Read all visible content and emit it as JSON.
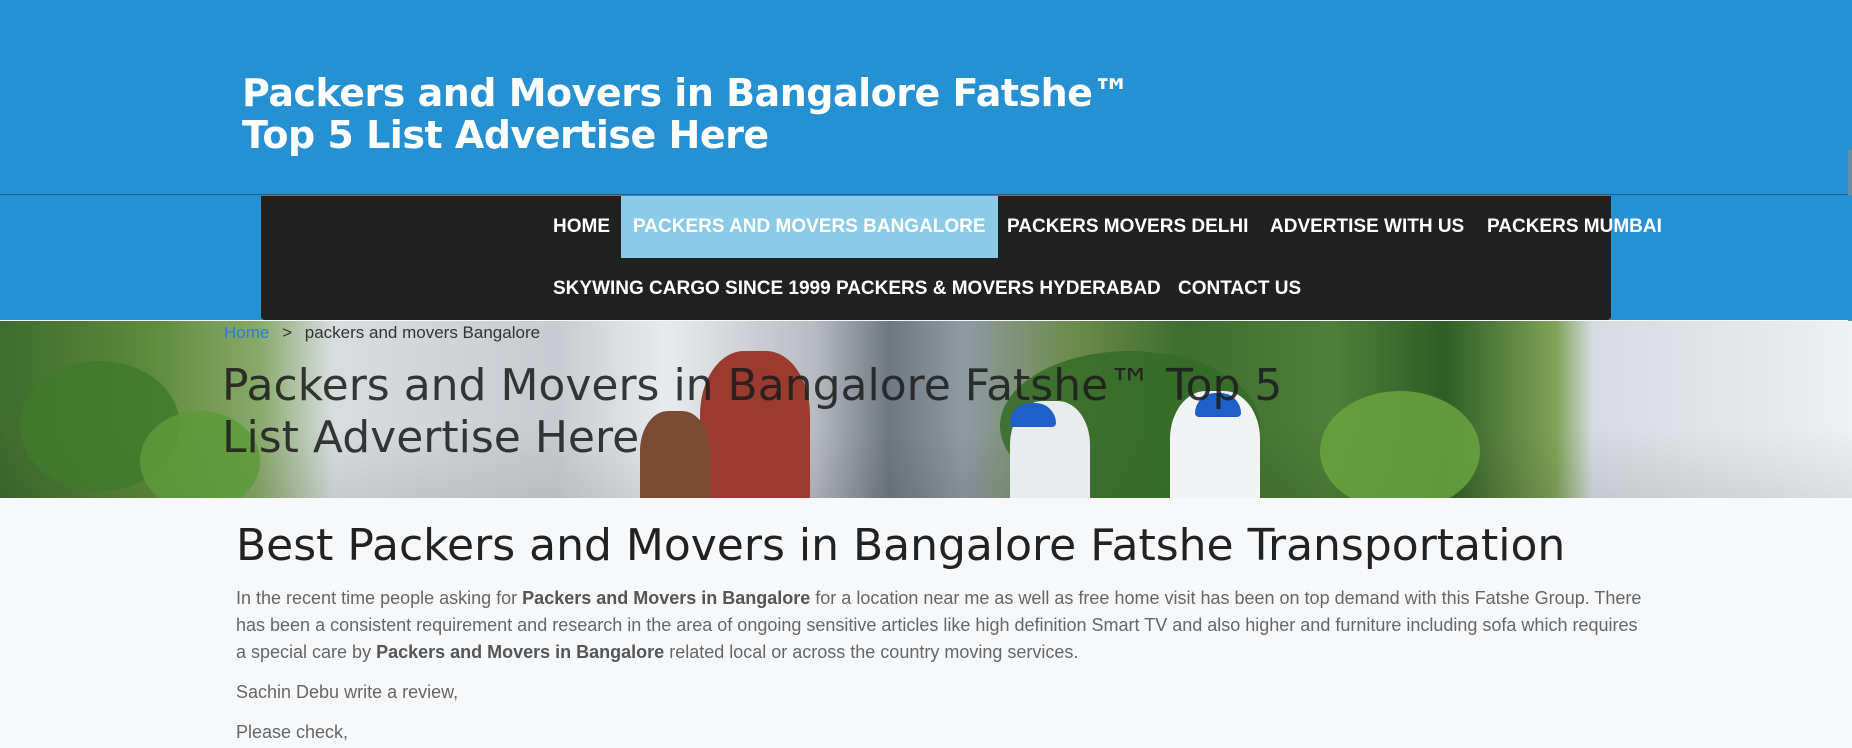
{
  "header": {
    "site_title": "Packers and Movers in Bangalore Fatshe™ Top 5 List Advertise Here",
    "bg_color": "#2591d2"
  },
  "nav": {
    "items": [
      {
        "label": "HOME"
      },
      {
        "label": "PACKERS AND MOVERS BANGALORE",
        "active": true
      },
      {
        "label": "PACKERS MOVERS DELHI"
      },
      {
        "label": "ADVERTISE WITH US"
      },
      {
        "label": "PACKERS MUMBAI"
      },
      {
        "label": "SKYWING CARGO SINCE 1999 PACKERS & MOVERS HYDERABAD"
      },
      {
        "label": "CONTACT US"
      }
    ],
    "bg_color": "#212121",
    "active_color": "#8ccbe7"
  },
  "hero": {
    "breadcrumb": {
      "home": "Home",
      "separator": ">",
      "current": "packers and movers Bangalore"
    },
    "title": "Packers and Movers in Bangalore Fatshe™ Top 5 List Advertise Here"
  },
  "content": {
    "heading": "Best Packers and Movers in Bangalore Fatshe Transportation",
    "para1": {
      "t1": "In the recent time people asking for ",
      "b1": "Packers and Movers in Bangalore",
      "t2": " for a location near me as well as free home visit has been on top demand with this Fatshe Group. There has been a consistent requirement and research in the area of ongoing sensitive articles like high definition Smart TV and also higher and furniture including sofa which requires a special care by ",
      "b2": "Packers and Movers in Bangalore",
      "t3": " related local or across the country moving services."
    },
    "para2": "Sachin Debu write a review,",
    "para3": "Please check,"
  }
}
